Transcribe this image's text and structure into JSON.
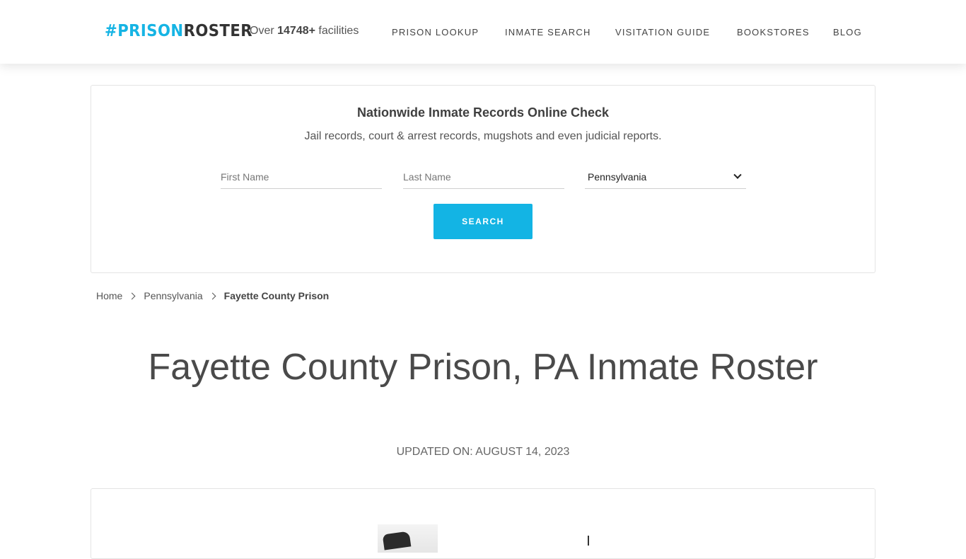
{
  "header": {
    "logo": {
      "hash": "#",
      "prison": "PRISON",
      "roster": "ROSTER"
    },
    "facilities": {
      "prefix": "Over",
      "count": "14748+",
      "suffix": "facilities"
    },
    "nav": [
      {
        "label": "PRISON LOOKUP"
      },
      {
        "label": "INMATE SEARCH"
      },
      {
        "label": "VISITATION GUIDE"
      },
      {
        "label": "BOOKSTORES"
      },
      {
        "label": "BLOG"
      }
    ]
  },
  "search": {
    "title": "Nationwide Inmate Records Online Check",
    "subtitle": "Jail records, court & arrest records, mugshots and even judicial reports.",
    "first_name_placeholder": "First Name",
    "last_name_placeholder": "Last Name",
    "state_selected": "Pennsylvania",
    "button_label": "SEARCH"
  },
  "breadcrumb": {
    "home": "Home",
    "state": "Pennsylvania",
    "current": "Fayette County Prison"
  },
  "page": {
    "title": "Fayette County Prison, PA Inmate Roster",
    "updated": "UPDATED ON: AUGUST 14, 2023"
  },
  "colors": {
    "accent": "#13b4e4",
    "text": "#4a4a4a"
  }
}
